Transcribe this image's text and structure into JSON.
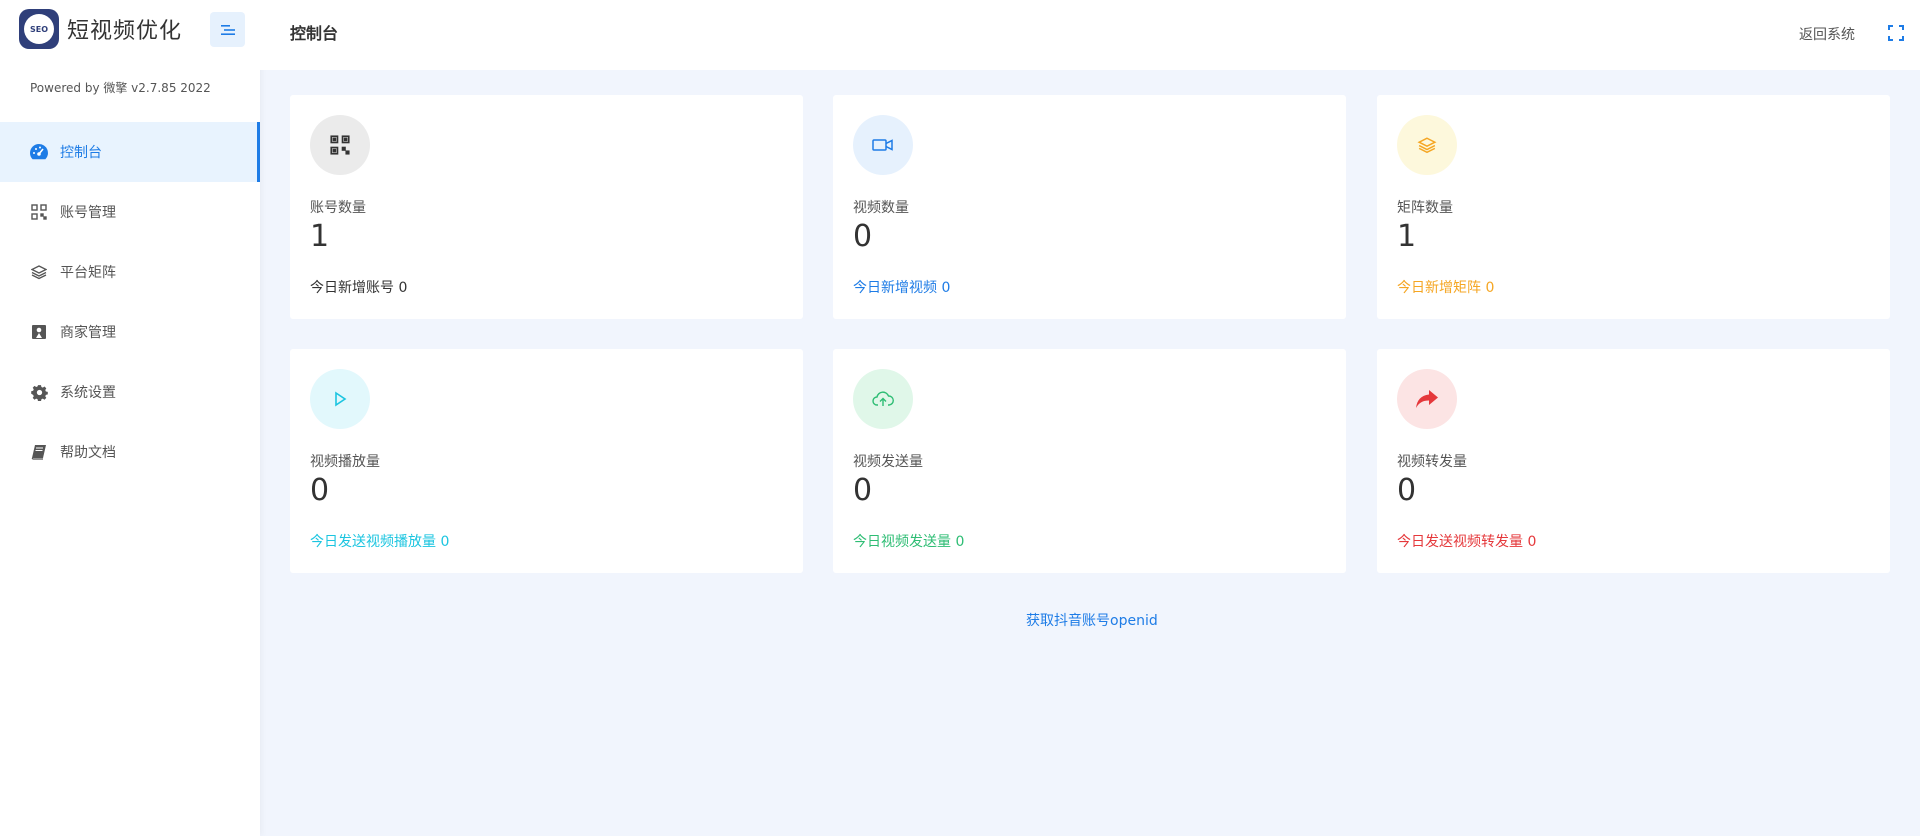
{
  "brand": {
    "title": "短视频优化",
    "logo_text": "SEO",
    "powered": "Powered by 微擎 v2.7.85 2022"
  },
  "menu": [
    {
      "label": "控制台",
      "icon": "dashboard-icon",
      "active": true
    },
    {
      "label": "账号管理",
      "icon": "qrcode-icon",
      "active": false
    },
    {
      "label": "平台矩阵",
      "icon": "layers-icon",
      "active": false
    },
    {
      "label": "商家管理",
      "icon": "merchant-icon",
      "active": false
    },
    {
      "label": "系统设置",
      "icon": "gear-icon",
      "active": false
    },
    {
      "label": "帮助文档",
      "icon": "book-icon",
      "active": false
    }
  ],
  "header": {
    "title": "控制台",
    "back": "返回系统"
  },
  "cards": [
    {
      "label": "账号数量",
      "value": "1",
      "sub": "今日新增账号 0",
      "icon": "qrcode-icon",
      "color": "#333333",
      "bg": "#ebebeb"
    },
    {
      "label": "视频数量",
      "value": "0",
      "sub": "今日新增视频 0",
      "icon": "video-camera-icon",
      "color": "#1e7ce6",
      "bg": "#e6f1fd"
    },
    {
      "label": "矩阵数量",
      "value": "1",
      "sub": "今日新增矩阵 0",
      "icon": "layers-icon",
      "color": "#f5a623",
      "bg": "#fdf8dc"
    },
    {
      "label": "视频播放量",
      "value": "0",
      "sub": "今日发送视频播放量 0",
      "icon": "play-icon",
      "color": "#1cc5e0",
      "bg": "#e2f8fc"
    },
    {
      "label": "视频发送量",
      "value": "0",
      "sub": "今日视频发送量 0",
      "icon": "cloud-upload-icon",
      "color": "#2ebd74",
      "bg": "#e0f7e9"
    },
    {
      "label": "视频转发量",
      "value": "0",
      "sub": "今日发送视频转发量 0",
      "icon": "share-icon",
      "color": "#e5383b",
      "bg": "#fce4e4"
    }
  ],
  "footer_link": "获取抖音账号openid"
}
